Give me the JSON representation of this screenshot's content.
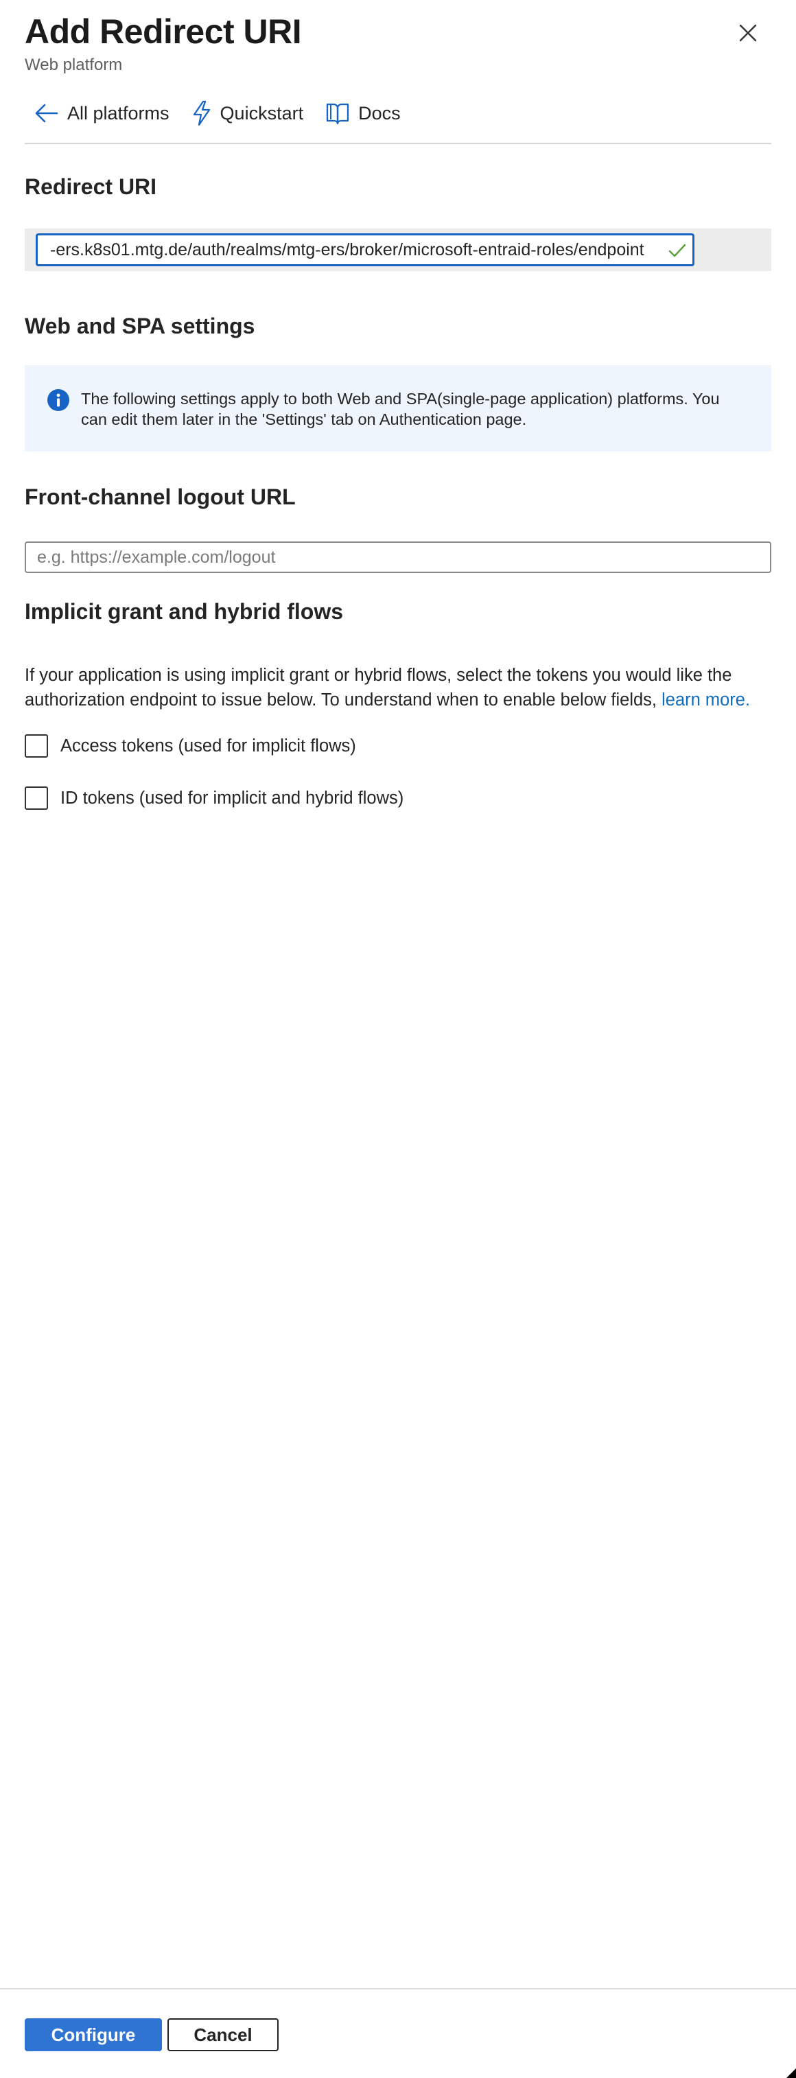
{
  "panel": {
    "title": "Add Redirect URI",
    "subtitle": "Web platform",
    "close_icon": "close-icon"
  },
  "toolbar": {
    "items": [
      {
        "label": "All platforms",
        "icon": "arrow-left-icon"
      },
      {
        "label": "Quickstart",
        "icon": "lightning-icon"
      },
      {
        "label": "Docs",
        "icon": "book-icon"
      }
    ]
  },
  "redirect": {
    "heading": "Redirect URI",
    "value": "-ers.k8s01.mtg.de/auth/realms/mtg-ers/broker/microsoft-entraid-roles/endpoint",
    "valid_icon": "checkmark-icon"
  },
  "web_spa": {
    "heading": "Web and SPA settings",
    "info_text": "The following settings apply to both Web and SPA(single-page application) platforms. You can edit them later in the 'Settings' tab on Authentication page.",
    "info_icon": "info-icon"
  },
  "logout": {
    "heading": "Front-channel logout URL",
    "placeholder": "e.g. https://example.com/logout",
    "value": ""
  },
  "implicit": {
    "heading": "Implicit grant and hybrid flows",
    "description": "If your application is using implicit grant or hybrid flows, select the tokens you would like the authorization endpoint to issue below. To understand when to enable below fields, ",
    "link_label": "learn more.",
    "options": [
      {
        "label": "Access tokens (used for implicit flows)",
        "checked": false
      },
      {
        "label": "ID tokens (used for implicit and hybrid flows)",
        "checked": false
      }
    ]
  },
  "footer": {
    "configure_label": "Configure",
    "cancel_label": "Cancel"
  },
  "colors": {
    "accent": "#2f73d3",
    "link": "#0f6cbd",
    "info_bg": "#eff5fc",
    "valid": "#5a9e3a"
  }
}
